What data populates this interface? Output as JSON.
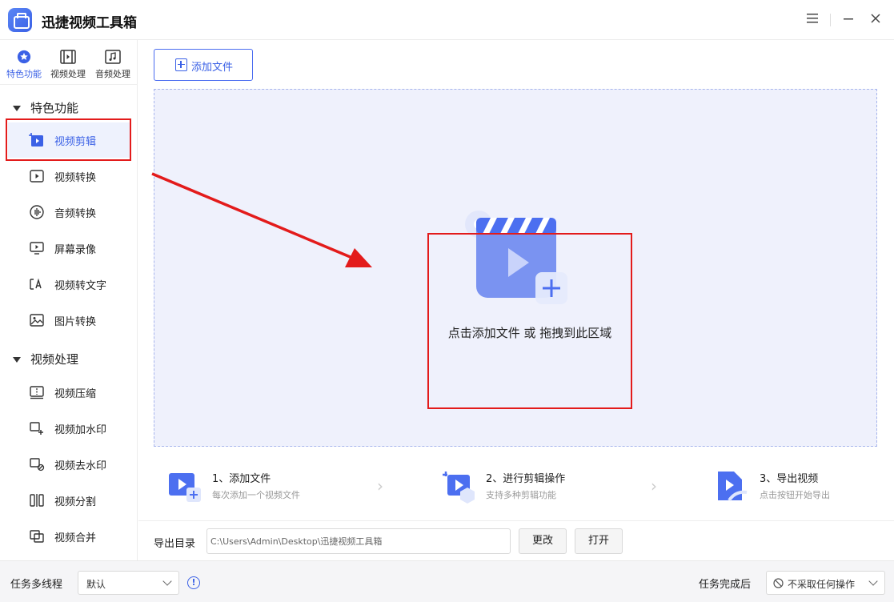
{
  "app": {
    "title": "迅捷视频工具箱"
  },
  "window_controls": {
    "menu_icon": "menu-icon",
    "minimize_icon": "minimize-icon",
    "close_icon": "close-icon"
  },
  "category_tabs": [
    {
      "label": "特色功能",
      "icon": "star-icon",
      "active": true
    },
    {
      "label": "视频处理",
      "icon": "film-icon",
      "active": false
    },
    {
      "label": "音频处理",
      "icon": "music-icon",
      "active": false
    }
  ],
  "sections": [
    {
      "title": "特色功能",
      "items": [
        {
          "label": "视频剪辑",
          "icon": "video-edit-icon",
          "active": true
        },
        {
          "label": "视频转换",
          "icon": "video-convert-icon"
        },
        {
          "label": "音频转换",
          "icon": "audio-convert-icon"
        },
        {
          "label": "屏幕录像",
          "icon": "screen-record-icon"
        },
        {
          "label": "视频转文字",
          "icon": "video-to-text-icon"
        },
        {
          "label": "图片转换",
          "icon": "image-convert-icon"
        }
      ]
    },
    {
      "title": "视频处理",
      "items": [
        {
          "label": "视频压缩",
          "icon": "video-compress-icon"
        },
        {
          "label": "视频加水印",
          "icon": "add-watermark-icon"
        },
        {
          "label": "视频去水印",
          "icon": "remove-watermark-icon"
        },
        {
          "label": "视频分割",
          "icon": "video-split-icon"
        },
        {
          "label": "视频合并",
          "icon": "video-merge-icon"
        }
      ]
    }
  ],
  "main": {
    "add_file_label": "添加文件",
    "drop_text": "点击添加文件 或 拖拽到此区域",
    "steps": [
      {
        "title": "1、添加文件",
        "subtitle": "每次添加一个视频文件"
      },
      {
        "title": "2、进行剪辑操作",
        "subtitle": "支持多种剪辑功能"
      },
      {
        "title": "3、导出视频",
        "subtitle": "点击按钮开始导出"
      }
    ],
    "export": {
      "label": "导出目录",
      "path": "C:\\Users\\Admin\\Desktop\\迅捷视频工具箱",
      "change_label": "更改",
      "open_label": "打开"
    }
  },
  "bottom": {
    "threads_label": "任务多线程",
    "threads_value": "默认",
    "after_label": "任务完成后",
    "after_value": "不采取任何操作"
  },
  "colors": {
    "accent": "#3b61e6",
    "highlight_red": "#e31b1b",
    "drop_bg": "#eff1fc"
  }
}
